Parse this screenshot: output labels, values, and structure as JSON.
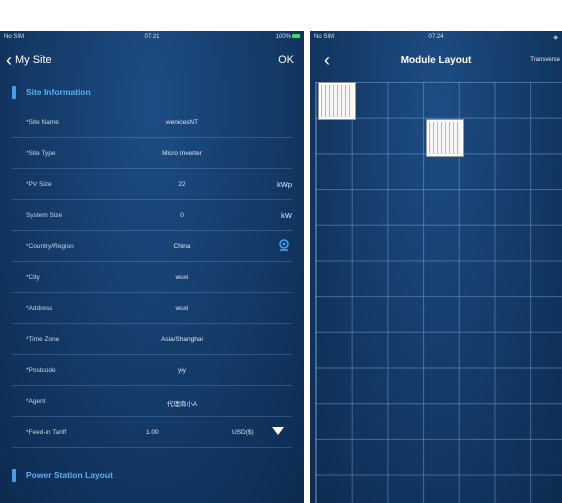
{
  "left_screen": {
    "status": {
      "carrier": "No SIM",
      "time": "07:21",
      "battery": "100%"
    },
    "nav": {
      "back_label": "My Site",
      "ok_label": "OK"
    },
    "section1_title": "Site Information",
    "fields": [
      {
        "label": "*Site Name",
        "value": "wenicesNT",
        "unit": ""
      },
      {
        "label": "*Site Type",
        "value": "Micro Inverter",
        "unit": ""
      },
      {
        "label": "*PV Size",
        "value": "22",
        "unit": "kWp"
      },
      {
        "label": "System Size",
        "value": "0",
        "unit": "kW"
      },
      {
        "label": "*Country/Region",
        "value": "China",
        "unit": ""
      },
      {
        "label": "*City",
        "value": "wuxi",
        "unit": ""
      },
      {
        "label": "*Address",
        "value": "wuxi",
        "unit": ""
      },
      {
        "label": "*Time Zone",
        "value": "Asia/Shanghai",
        "unit": ""
      },
      {
        "label": "*Postcode",
        "value": "yiy",
        "unit": ""
      },
      {
        "label": "*Agent",
        "value": "代理商小A",
        "unit": ""
      }
    ],
    "tariff": {
      "label": "*Feed-in Tariff",
      "value": "1.00",
      "currency": "USD($)"
    },
    "section2_title": "Power Station Layout",
    "icons": {
      "location": "location-pin-icon",
      "dropdown": "triangle-down-icon",
      "back": "chevron-left-icon"
    },
    "colors": {
      "accent": "#3fa0f2",
      "background": "#153d6c"
    }
  },
  "right_screen": {
    "status": {
      "carrier": "No SIM",
      "time": "07:24"
    },
    "nav": {
      "title": "Module Layout",
      "action_label": "Transverse"
    },
    "grid": {
      "columns": 7,
      "rows": 12,
      "modules": 2
    }
  }
}
